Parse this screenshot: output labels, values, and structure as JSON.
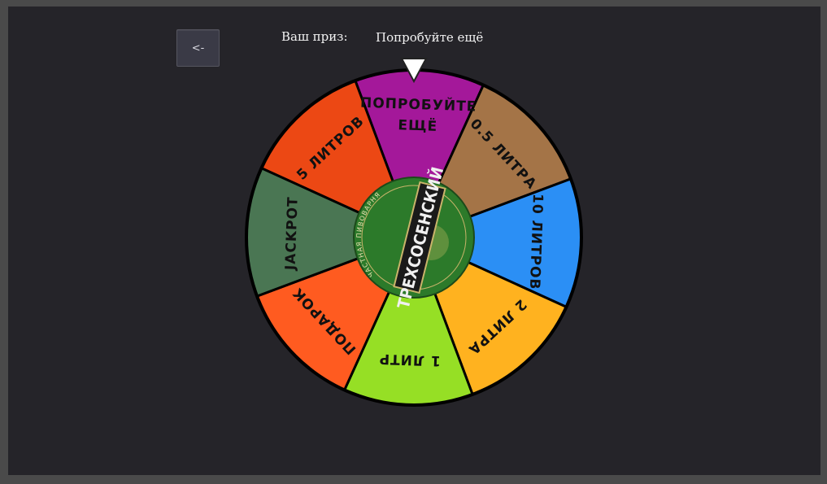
{
  "back_button": {
    "label": "<-"
  },
  "prize": {
    "label": "Ваш приз:",
    "value": "Попробуйте ещё"
  },
  "wheel": {
    "segments": [
      {
        "lines": [
          "ПОПРОБУЙТЕ",
          "ЕЩЁ"
        ],
        "color": "#a4189a"
      },
      {
        "lines": [
          "0.5 ЛИТРА"
        ],
        "color": "#a47447"
      },
      {
        "lines": [
          "10 ЛИТРОВ"
        ],
        "color": "#2b8ff5"
      },
      {
        "lines": [
          "2 ЛИТРА"
        ],
        "color": "#ffb21f"
      },
      {
        "lines": [
          "1 ЛИТР"
        ],
        "color": "#96df25"
      },
      {
        "lines": [
          "ПОДАРОК"
        ],
        "color": "#ff5b20"
      },
      {
        "lines": [
          "JACKPOT"
        ],
        "color": "#4a7653"
      },
      {
        "lines": [
          "5 ЛИТРОВ"
        ],
        "color": "#ec4814"
      }
    ],
    "center_logo": {
      "title": "ТРЕХСОСЕНСКИЙ",
      "subtitle": "ЧАСТНАЯ ПИВОВАРНЯ",
      "color": "#2c7a2a"
    },
    "pointer_color": "#ffffff"
  }
}
